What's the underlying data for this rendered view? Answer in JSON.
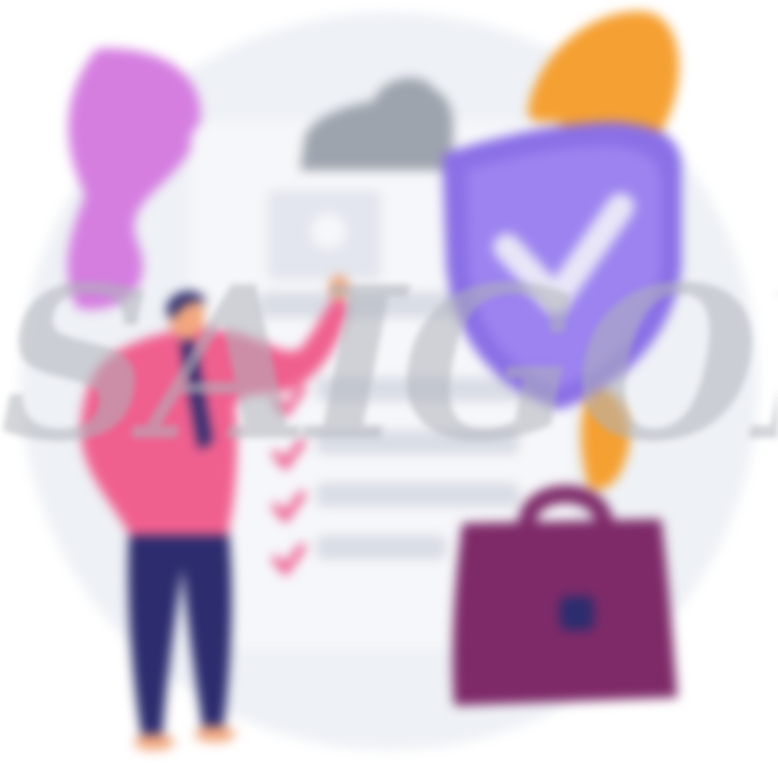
{
  "scene": {
    "subject": "insurance-approval-illustration",
    "colors": {
      "background_circle": "#eef1f6",
      "plant_pink": "#d57ee0",
      "plant_orange": "#f5a032",
      "clipboard_paper": "#f6f7fa",
      "clipboard_clip": "#9ea4ae",
      "shield": "#8a6fe6",
      "shield_inner": "#9c83f0",
      "check_mark": "#e8e6f7",
      "checklist_tick": "#ee5a8c",
      "checklist_line": "#d9dde5",
      "person_shirt": "#f0608f",
      "person_pants": "#2c2c6e",
      "person_skin": "#f2a77e",
      "briefcase": "#7e2a68",
      "briefcase_clasp": "#2c2c6e"
    }
  },
  "watermark": {
    "text": "SAIGON"
  }
}
